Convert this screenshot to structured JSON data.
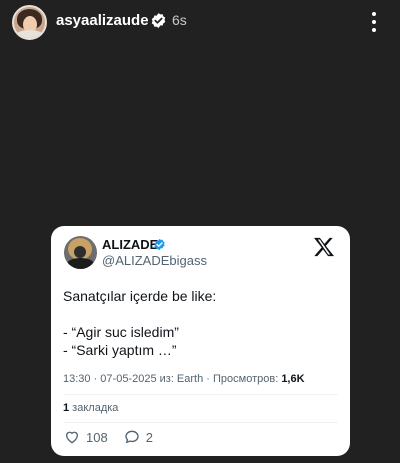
{
  "story": {
    "username": "asyaalizaude",
    "time_ago": "6s",
    "icons": {
      "avatar": "profile-avatar",
      "verified": "verified-badge-icon",
      "menu": "more-vertical-icon"
    }
  },
  "tweet": {
    "name": "ALIZADE",
    "handle": "@ALIZADEbigass",
    "text_lines": [
      "Sanatçılar içerde be like:",
      "- “Agir suc isledim”",
      "- “Sarki yaptım …”"
    ],
    "meta_prefix": "13:30 · 07-05-2025 из: Earth · Просмотров: ",
    "views": "1,6K",
    "bookmarks_count": "1",
    "bookmarks_label": " закладка",
    "likes": "108",
    "replies": "2",
    "colors": {
      "verified": "#1d9bf0",
      "text": "#0f1419",
      "secondary": "#536471",
      "background": "#212121"
    },
    "icons": {
      "logo": "x-logo-icon",
      "like": "heart-icon",
      "reply": "reply-icon"
    }
  }
}
